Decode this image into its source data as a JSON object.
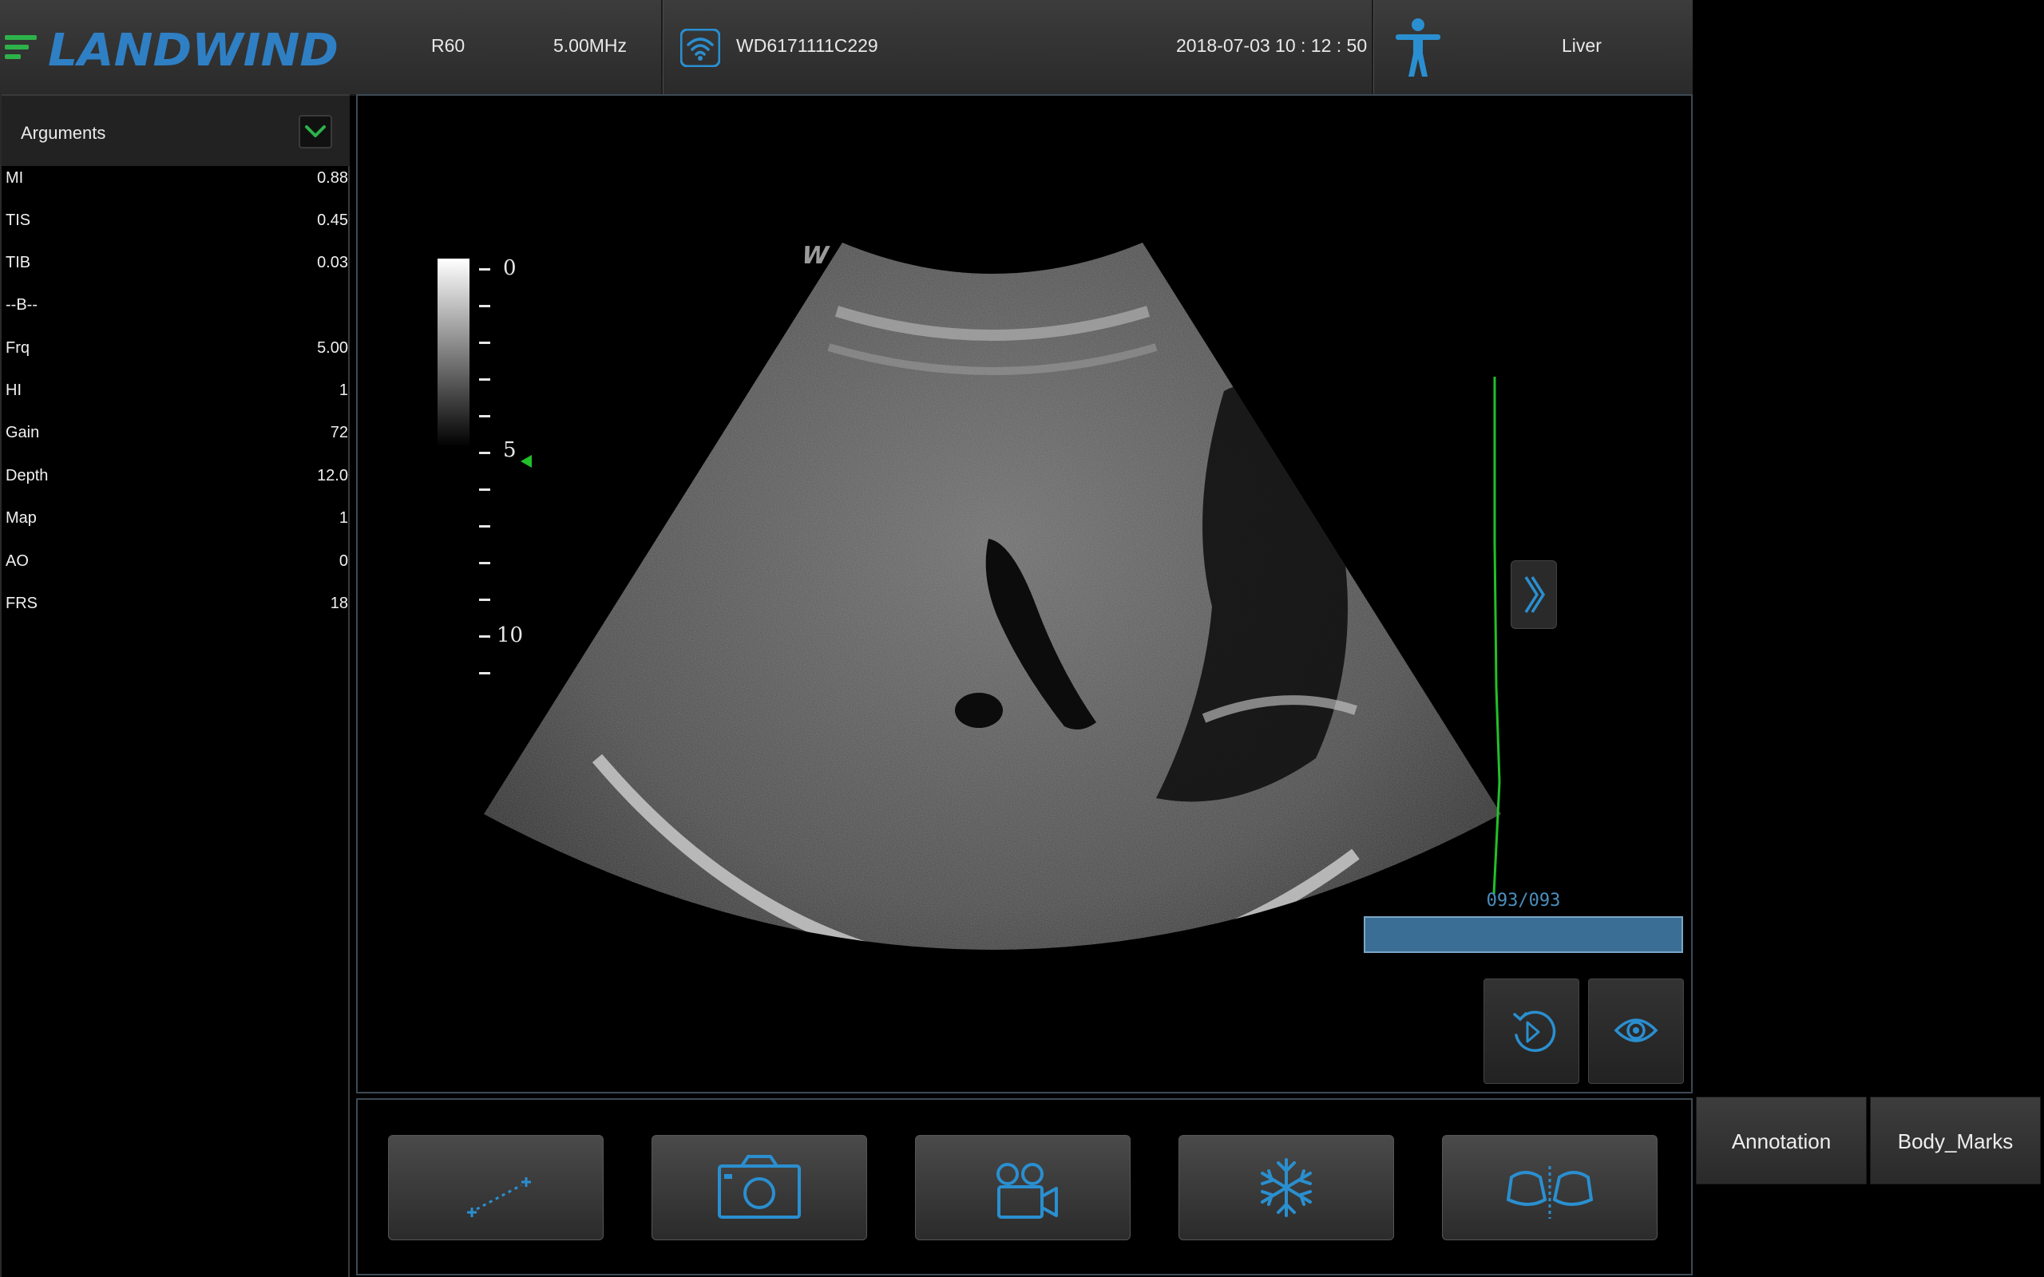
{
  "header": {
    "brand": "LANDWIND",
    "probe": "R60",
    "frequency": "5.00MHz",
    "device_id": "WD6171111C229",
    "datetime": "2018-07-03  10 : 12 : 50",
    "preset": "Liver"
  },
  "arguments": {
    "title": "Arguments",
    "rows": [
      {
        "key": "MI",
        "value": "0.88"
      },
      {
        "key": "TIS",
        "value": "0.45"
      },
      {
        "key": "TIB",
        "value": "0.03"
      },
      {
        "key": "--B--",
        "value": ""
      },
      {
        "key": "Frq",
        "value": "5.00"
      },
      {
        "key": "HI",
        "value": "1"
      },
      {
        "key": "Gain",
        "value": "72"
      },
      {
        "key": "Depth",
        "value": "12.0"
      },
      {
        "key": "Map",
        "value": "1"
      },
      {
        "key": "AO",
        "value": "0"
      },
      {
        "key": "FRS",
        "value": "18"
      }
    ]
  },
  "image": {
    "depth_labels": [
      "0",
      "5",
      "10"
    ],
    "focus_depth": 5,
    "cine_counter": "093/093",
    "cine_progress": 1.0
  },
  "toolbar": {
    "tools": [
      "measure-icon",
      "camera-icon",
      "video-camera-icon",
      "freeze-icon",
      "dual-view-icon"
    ]
  },
  "side_buttons": {
    "annotation": "Annotation",
    "body_marks": "Body_Marks"
  },
  "colors": {
    "accent_blue": "#2a8fd0",
    "brand_green": "#2db24a",
    "brand_blue": "#2f7fc4",
    "tgc_green": "#22c02a"
  }
}
